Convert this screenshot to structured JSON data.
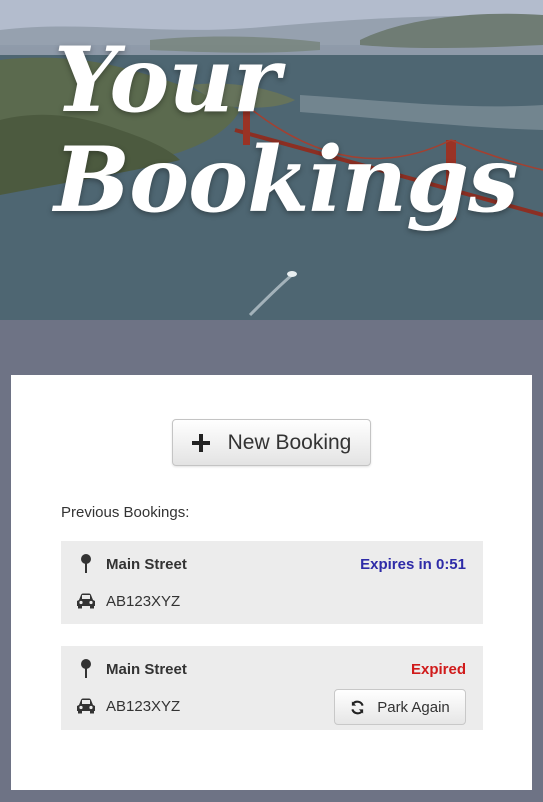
{
  "hero": {
    "title": "Your\nBookings"
  },
  "actions": {
    "new_booking_label": "New Booking"
  },
  "previous": {
    "label": "Previous Bookings:",
    "bookings": [
      {
        "location": "Main Street",
        "plate": "AB123XYZ",
        "status": "Expires in 0:51",
        "status_color": "#2e2ba8"
      },
      {
        "location": "Main Street",
        "plate": "AB123XYZ",
        "status": "Expired",
        "status_color": "#d01b1b",
        "action_label": "Park Again"
      }
    ]
  },
  "icons": {
    "new_booking": "plus-icon",
    "location": "map-pin-icon",
    "vehicle": "car-icon",
    "park_again": "refresh-icon"
  },
  "colors": {
    "page_background": "#6e7385",
    "card_background": "#ffffff",
    "booking_background": "#ececec"
  }
}
